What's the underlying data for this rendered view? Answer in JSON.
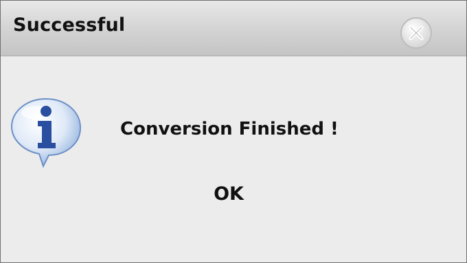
{
  "dialog": {
    "title": "Successful",
    "close_icon": "close-icon",
    "message": "Conversion Finished !",
    "info_icon": "info-icon",
    "ok_label": "OK"
  },
  "colors": {
    "titlebar": "#d6d6d6",
    "background": "#ececec",
    "info_icon": "#2f5fb0"
  }
}
